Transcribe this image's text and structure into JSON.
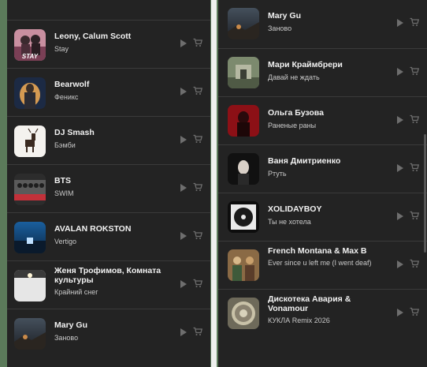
{
  "left_panel": {
    "tracks": [
      {
        "artist": "Leony, Calum Scott",
        "title": "Stay",
        "cover_text": "STAY"
      },
      {
        "artist": "Bearwolf",
        "title": "Феникс"
      },
      {
        "artist": "DJ Smash",
        "title": "Бэмби"
      },
      {
        "artist": "BTS",
        "title": "SWIM"
      },
      {
        "artist": "AVALAN ROKSTON",
        "title": "Vertigo"
      },
      {
        "artist": "Женя Трофимов, Комната культуры",
        "title": "Крайний снег"
      },
      {
        "artist": "Mary Gu",
        "title": "Заново"
      }
    ]
  },
  "right_panel": {
    "tracks": [
      {
        "artist": "Mary Gu",
        "title": "Заново"
      },
      {
        "artist": "Мари Краймбрери",
        "title": "Давай не ждать"
      },
      {
        "artist": "Ольга Бузова",
        "title": "Раненые раны"
      },
      {
        "artist": "Ваня Дмитриенко",
        "title": "Ртуть"
      },
      {
        "artist": "XOLIDAYBOY",
        "title": "Ты не хотела"
      },
      {
        "artist": "French Montana & Max B",
        "title": "Ever since u left me (I went deaf)"
      },
      {
        "artist": "Дискотека Авария & Vonamour",
        "title": "КУКЛА Remix 2026"
      }
    ]
  },
  "icons": {
    "play": "play-icon",
    "cart": "cart-icon"
  },
  "colors": {
    "panel": "#232323",
    "artist": "#f2f2f2",
    "title": "#c8c8c8",
    "icon": "#6e6e6e"
  }
}
